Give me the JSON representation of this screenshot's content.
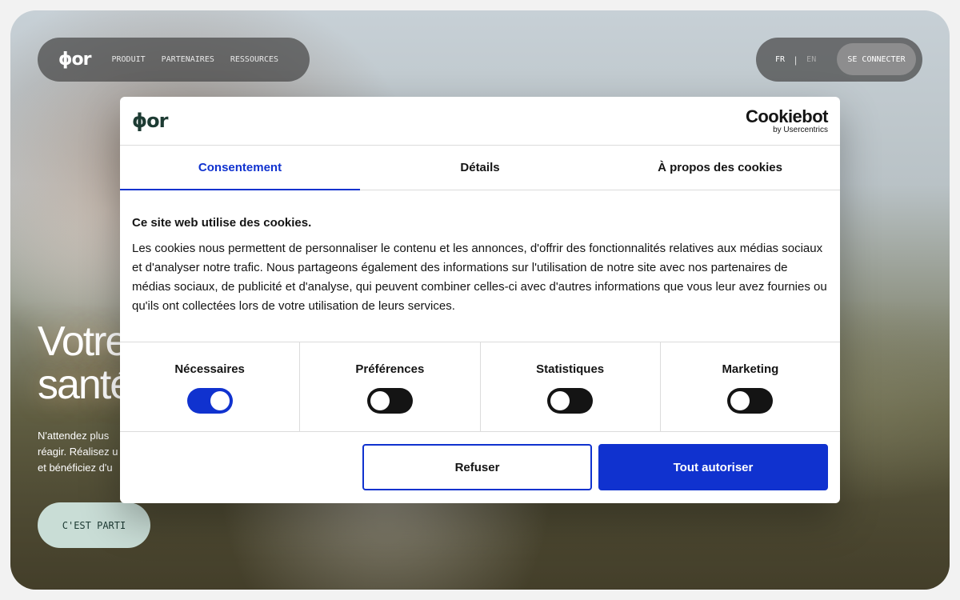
{
  "brand": {
    "logo_text": "ϕor"
  },
  "nav": {
    "links": [
      "PRODUIT",
      "PARTENAIRES",
      "RESSOURCES"
    ],
    "lang_fr": "FR",
    "lang_sep": "|",
    "lang_en": "EN",
    "connect_label": "SE CONNECTER"
  },
  "hero": {
    "title_line1": "Votre",
    "title_line2": "santé",
    "subtitle_line1": "N'attendez plus",
    "subtitle_line2": "réagir. Réalisez u",
    "subtitle_line3": "et bénéficiez d'u",
    "cta_label": "C'EST PARTI"
  },
  "cookie_dialog": {
    "logo_text": "ϕor",
    "provider_name": "Cookiebot",
    "provider_by": "by Usercentrics",
    "tabs": [
      "Consentement",
      "Détails",
      "À propos des cookies"
    ],
    "active_tab": "Consentement",
    "title": "Ce site web utilise des cookies.",
    "body": "Les cookies nous permettent de personnaliser le contenu et les annonces, d'offrir des fonctionnalités relatives aux médias sociaux et d'analyser notre trafic. Nous partageons également des informations sur l'utilisation de notre site avec nos partenaires de médias sociaux, de publicité et d'analyse, qui peuvent combiner celles-ci avec d'autres informations que vous leur avez fournies ou qu'ils ont collectées lors de votre utilisation de leurs services.",
    "categories": [
      {
        "label": "Nécessaires",
        "enabled": true
      },
      {
        "label": "Préférences",
        "enabled": false
      },
      {
        "label": "Statistiques",
        "enabled": false
      },
      {
        "label": "Marketing",
        "enabled": false
      }
    ],
    "refuse_label": "Refuser",
    "allow_label": "Tout autoriser"
  },
  "colors": {
    "accent": "#1032cf",
    "text": "#141414",
    "logo_dark": "#1d3b33",
    "cta_bg": "#c9ddd6"
  }
}
